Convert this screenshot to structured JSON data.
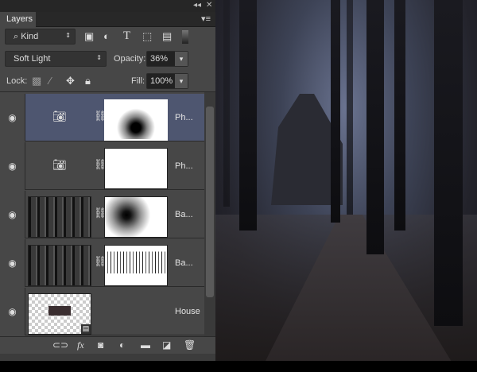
{
  "panel": {
    "tab_label": "Layers",
    "collapse_icon": "double-chevron-left",
    "close_icon": "x",
    "menu_icon": "panel-menu"
  },
  "filter": {
    "kind_label": "Kind",
    "icons": [
      "pixel-filter",
      "adjustment-filter",
      "type-filter",
      "shape-filter",
      "smart-object-filter"
    ]
  },
  "blend": {
    "mode": "Soft Light",
    "opacity_label": "Opacity:",
    "opacity_value": "36%"
  },
  "lock": {
    "label": "Lock:",
    "fill_label": "Fill:",
    "fill_value": "100%"
  },
  "layers": [
    {
      "name": "Ph...",
      "type": "photo-filter",
      "active": true
    },
    {
      "name": "Ph...",
      "type": "photo-filter",
      "active": false
    },
    {
      "name": "Ba...",
      "type": "bitmap",
      "active": false
    },
    {
      "name": "Ba...",
      "type": "bitmap",
      "active": false
    },
    {
      "name": "House",
      "type": "smart-object",
      "active": false
    }
  ],
  "bottom_icons": [
    "link-layers",
    "fx",
    "add-mask",
    "new-adjustment",
    "new-group",
    "new-layer",
    "delete-layer"
  ],
  "glyphs": {
    "eye": "◉",
    "link": "⛓",
    "fx": "fx",
    "dd": "▾"
  }
}
